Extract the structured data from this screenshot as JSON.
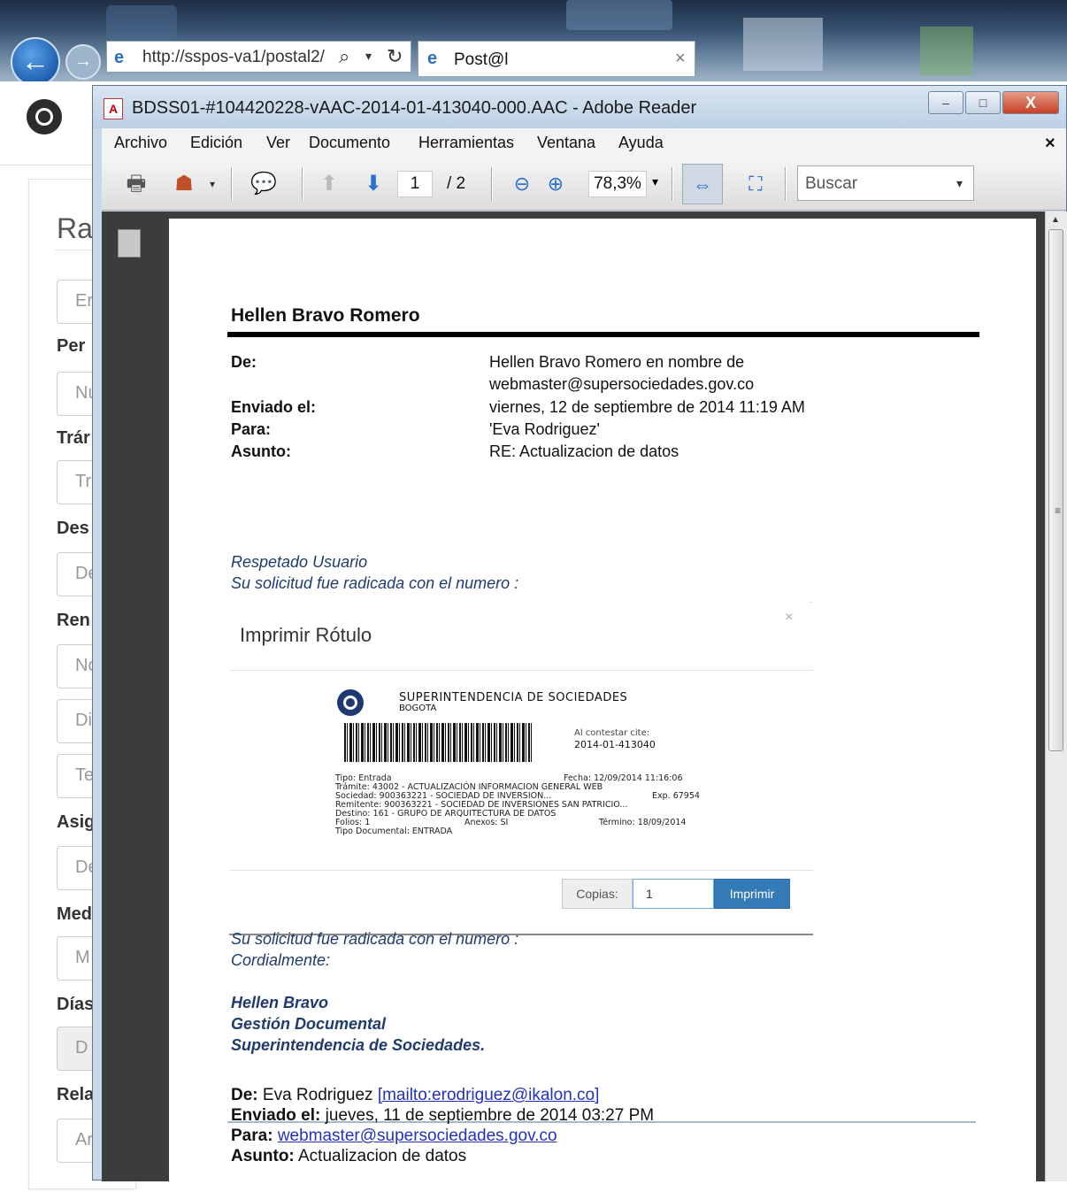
{
  "browser": {
    "address_url": "http://sspos-va1/postal2/",
    "tab_title": "Post@l",
    "back_label": "←",
    "forward_label": "→",
    "search_glyph": "⌕",
    "dropdown_glyph": "▾",
    "refresh_glyph": "↻",
    "tab_close": "×"
  },
  "background_page": {
    "title": "Ra",
    "fields": [
      {
        "label": "",
        "placeholder": "Er"
      },
      {
        "label": "Per",
        "placeholder": "Nu"
      },
      {
        "label": "Trár",
        "placeholder": "Tr"
      },
      {
        "label": "Des",
        "placeholder": "De"
      },
      {
        "label": "Ren",
        "placeholder": "No"
      },
      {
        "label": "",
        "placeholder": "Di"
      },
      {
        "label": "",
        "placeholder": "Te"
      },
      {
        "label": "Asig",
        "placeholder": "De"
      },
      {
        "label": "Med",
        "placeholder": "M"
      },
      {
        "label": "Días",
        "placeholder": "D"
      },
      {
        "label": "Rela",
        "placeholder": "Ar"
      }
    ]
  },
  "reader": {
    "window_title": "BDSS01-#104420228-vAAC-2014-01-413040-000.AAC - Adobe Reader",
    "window_buttons": {
      "minimize": "–",
      "maximize": "□",
      "close": "X"
    },
    "menu": [
      "Archivo",
      "Edición",
      "Ver",
      "Documento",
      "Herramientas",
      "Ventana",
      "Ayuda"
    ],
    "menu_close": "×",
    "page_current": "1",
    "page_total": "/ 2",
    "zoom": "78,3%",
    "search_placeholder": "Buscar",
    "icons": [
      "print-icon",
      "share-icon",
      "comment-icon",
      "previous-page-icon",
      "next-page-icon",
      "zoom-out-icon",
      "zoom-in-icon",
      "fit-width-icon",
      "fit-page-icon",
      "pages-panel-icon"
    ]
  },
  "email": {
    "sender_heading": "Hellen Bravo Romero",
    "meta": [
      {
        "label": "De:",
        "value": "Hellen Bravo Romero en nombre de"
      },
      {
        "label": "",
        "value": "webmaster@supersociedades.gov.co"
      },
      {
        "label": "Enviado el:",
        "value": "viernes, 12 de septiembre de 2014 11:19 AM"
      },
      {
        "label": "Para:",
        "value": "'Eva Rodriguez'"
      },
      {
        "label": "Asunto:",
        "value": "RE: Actualizacion de datos"
      }
    ],
    "greeting": "Respetado Usuario",
    "intro": "Su solicitud fue radicada con el numero :",
    "modal": {
      "title": "Imprimir Rótulo",
      "close": "×",
      "label": {
        "org": "SUPERINTENDENCIA DE SOCIEDADES",
        "city": "BOGOTA",
        "cite": "Al contestar cite:",
        "number": "2014-01-413040",
        "tipo": "Tipo: Entrada",
        "fecha": "Fecha: 12/09/2014 11:16:06",
        "tramite": "Trámite: 43002 - ACTUALIZACIÓN INFORMACION GENERAL WEB",
        "sociedad": "Sociedad: 900363221 - SOCIEDAD DE INVERSION...",
        "exp": "Exp. 67954",
        "remitente": "Remitente: 900363221 - SOCIEDAD DE INVERSIONES SAN PATRICIO...",
        "destino": "Destino: 161 - GRUPO DE ARQUITECTURA DE DATOS",
        "folios": "Folios: 1",
        "anexos": "Anexos: SI",
        "termino": "Término: 18/09/2014",
        "tipo_doc": "Tipo Documental: ENTRADA"
      },
      "copias_label": "Copias:",
      "copias_value": "1",
      "print_button": "Imprimir"
    },
    "outro": "Su solicitud fue radicada con el numero :",
    "closing": "Cordialmente:",
    "signature": [
      "Hellen Bravo",
      "Gestión Documental",
      "Superintendencia de Sociedades."
    ],
    "quoted": {
      "from_label": "De:",
      "from_name": "Eva Rodriguez",
      "from_link": "[mailto:erodriguez@ikalon.co]",
      "sent_label": "Enviado el:",
      "sent_value": "jueves, 11 de septiembre de 2014 03:27 PM",
      "to_label": "Para:",
      "to_value": "webmaster@supersociedades.gov.co",
      "subject_label": "Asunto:",
      "subject_value": "Actualizacion de datos"
    }
  }
}
